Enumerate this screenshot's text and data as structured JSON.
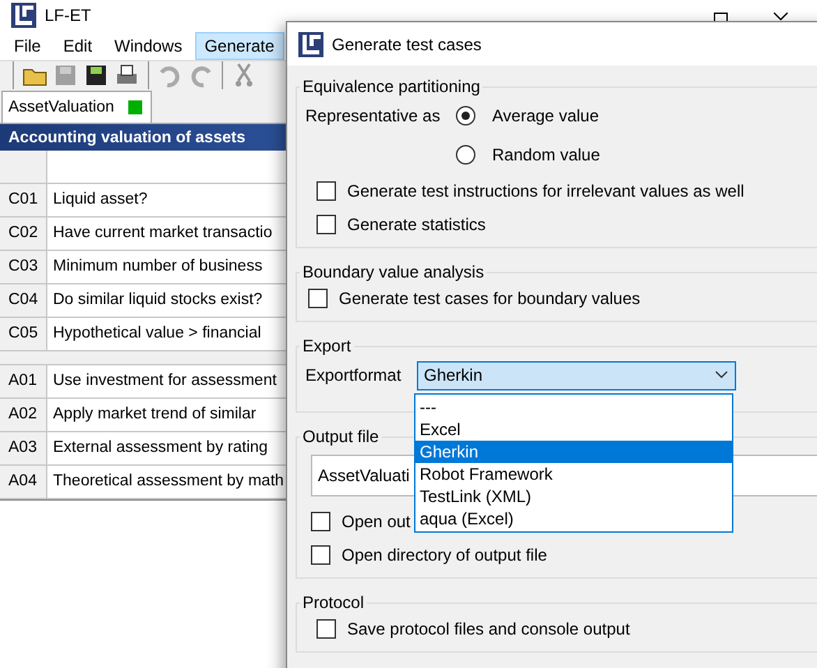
{
  "main_window": {
    "title": "LF-ET",
    "menu": [
      {
        "label": "File",
        "selected": false
      },
      {
        "label": "Edit",
        "selected": false
      },
      {
        "label": "Windows",
        "selected": false
      },
      {
        "label": "Generate",
        "selected": true
      }
    ],
    "tab": {
      "label": "AssetValuation"
    },
    "table_title": "Accounting valuation of assets",
    "conditions": [
      {
        "id": "C01",
        "text": "Liquid asset?"
      },
      {
        "id": "C02",
        "text": "Have current market transactio"
      },
      {
        "id": "C03",
        "text": "Minimum number of business"
      },
      {
        "id": "C04",
        "text": "Do similar liquid stocks exist?"
      },
      {
        "id": "C05",
        "text": "Hypothetical value > financial"
      }
    ],
    "actions": [
      {
        "id": "A01",
        "text": "Use investment for assessment"
      },
      {
        "id": "A02",
        "text": "Apply market trend of similar"
      },
      {
        "id": "A03",
        "text": "External assessment by rating"
      },
      {
        "id": "A04",
        "text": "Theoretical assessment by math"
      }
    ]
  },
  "dialog": {
    "title": "Generate test cases",
    "equivalence": {
      "title": "Equivalence partitioning",
      "label": "Representative as",
      "options": [
        {
          "label": "Average value",
          "selected": true
        },
        {
          "label": "Random value",
          "selected": false
        }
      ],
      "checks": [
        {
          "label": "Generate test instructions for irrelevant values as well",
          "checked": false
        },
        {
          "label": "Generate statistics",
          "checked": false
        }
      ]
    },
    "boundary": {
      "title": "Boundary value analysis",
      "checks": [
        {
          "label": "Generate test cases for boundary values",
          "checked": false
        }
      ]
    },
    "export": {
      "title": "Export",
      "label": "Exportformat",
      "value": "Gherkin",
      "expanded": true,
      "options": [
        {
          "label": "---",
          "selected": false
        },
        {
          "label": "Excel",
          "selected": false
        },
        {
          "label": "Gherkin",
          "selected": true
        },
        {
          "label": "Robot Framework",
          "selected": false
        },
        {
          "label": "TestLink (XML)",
          "selected": false
        },
        {
          "label": "aqua (Excel)",
          "selected": false
        }
      ]
    },
    "output": {
      "title": "Output file",
      "value": "AssetValuati",
      "checks": [
        {
          "label": "Open out",
          "checked": false
        },
        {
          "label": "Open directory of output file",
          "checked": false
        }
      ]
    },
    "protocol": {
      "title": "Protocol",
      "checks": [
        {
          "label": "Save protocol files and console output",
          "checked": false
        }
      ]
    }
  }
}
